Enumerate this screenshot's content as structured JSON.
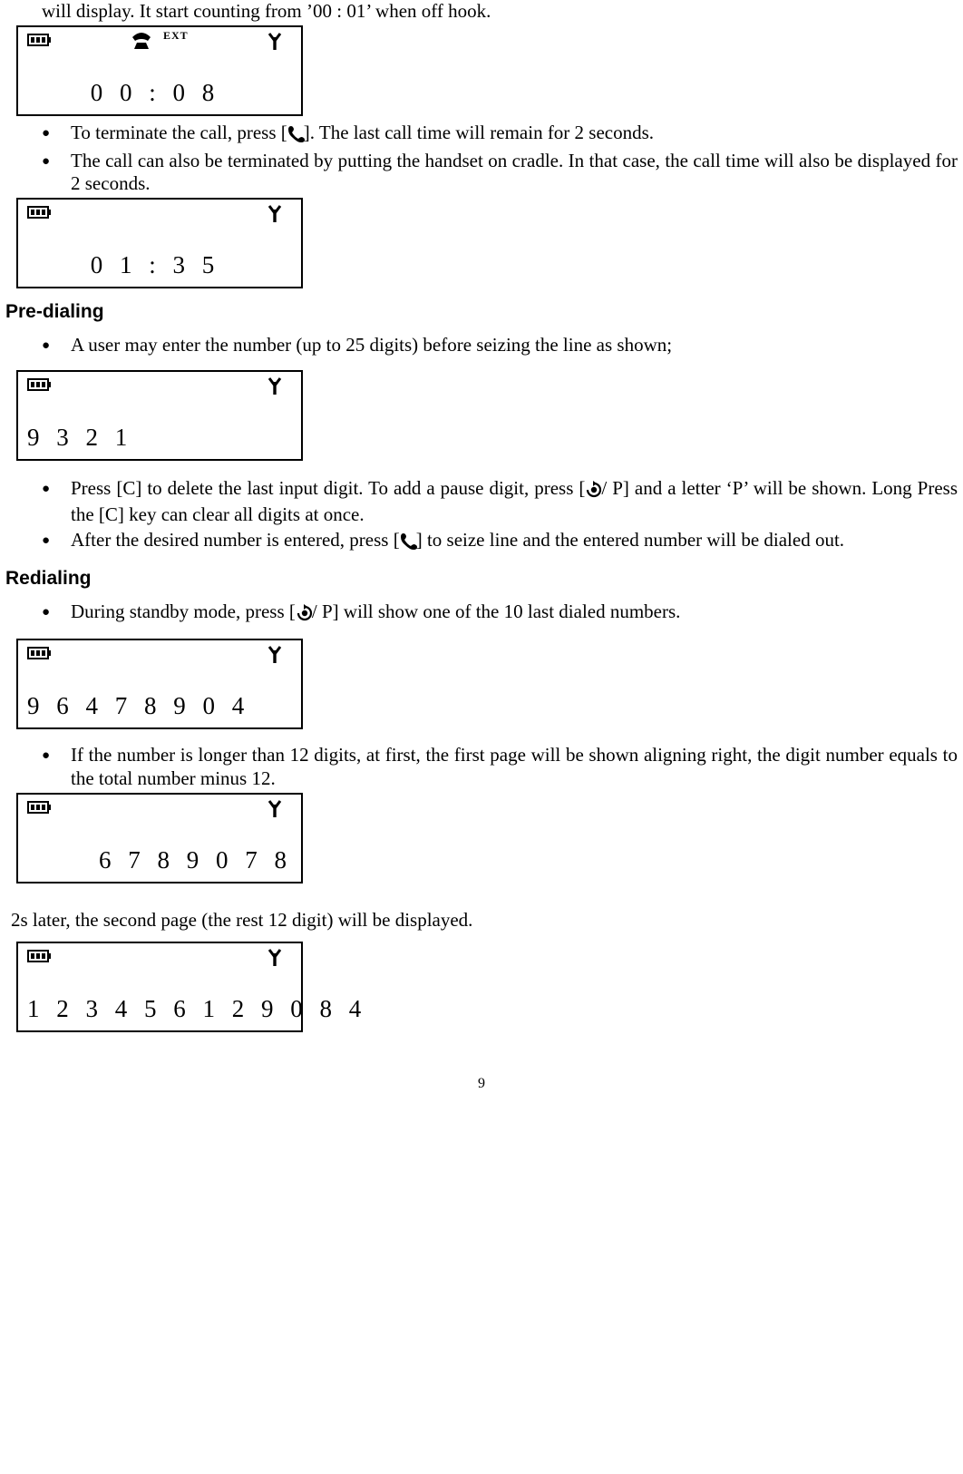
{
  "para0": "will display. It start counting from ’00 : 01’ when off hook.",
  "lcd1": {
    "ext": "EXT",
    "digits": "0 0 : 0 8"
  },
  "bullets_a": [
    "To terminate the call, press [☎]. The last call time will remain for 2 seconds.",
    "The call can also be terminated by putting the handset on cradle. In that case, the call time will also be displayed for 2 seconds."
  ],
  "lcd2": {
    "digits": "0 1 : 3 5"
  },
  "heading1": "Pre-dialing",
  "bullets_b": [
    "A user may enter the number (up to 25 digits) before seizing the line as shown;"
  ],
  "lcd3": {
    "digits": "9 3 2 1"
  },
  "bullets_c": [
    "Press [C] to delete the last input digit. To add a pause digit, press [☽/ P] and a letter ‘P’ will be shown. Long Press the [C] key can clear all digits at once.",
    "After the desired number is entered, press [☎] to seize line and the entered number will be dialed out."
  ],
  "heading2": "Redialing",
  "bullets_d": [
    "During standby mode, press [☽/ P] will show one of the 10 last dialed numbers."
  ],
  "lcd4": {
    "digits": "9 6 4 7 8 9 0 4"
  },
  "bullets_e": [
    "If the number is longer than 12 digits, at first, the first page will be shown aligning right, the digit number equals to the total number minus 12."
  ],
  "lcd5": {
    "digits": "6 7 8 9 0 7 8"
  },
  "para_f": "2s later, the second page (the rest 12 digit) will be displayed.",
  "lcd6": {
    "digits": "1 2 3 4 5 6 1 2 9 0 8 4"
  },
  "page_number": "9"
}
